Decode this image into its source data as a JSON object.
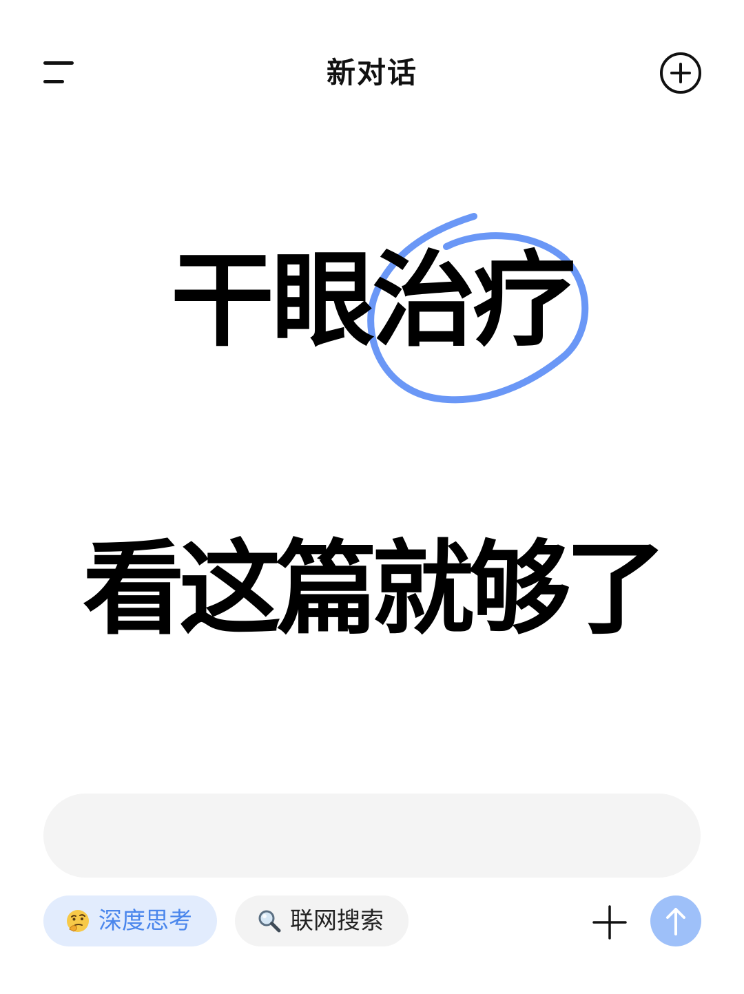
{
  "header": {
    "title": "新对话",
    "menu_icon": "menu-icon",
    "new_chat_icon": "plus-circle-icon"
  },
  "headline": {
    "line1": "干眼治疗",
    "line2": "看这篇就够了",
    "circled_text": "治疗",
    "circle_color": "#6a97f6"
  },
  "input": {
    "placeholder": "",
    "value": ""
  },
  "toolbar": {
    "deep_think_label": "深度思考",
    "deep_think_icon": "thinking-face-icon",
    "web_search_label": "联网搜索",
    "web_search_icon": "magnifier-icon",
    "attach_icon": "plus-icon",
    "send_icon": "arrow-up-icon"
  },
  "colors": {
    "accent": "#4a86ec",
    "chip_active_bg": "#e2ecfd",
    "chip_bg": "#f3f3f3",
    "input_bg": "#f4f4f4",
    "send_bg": "#9ec0f9"
  }
}
